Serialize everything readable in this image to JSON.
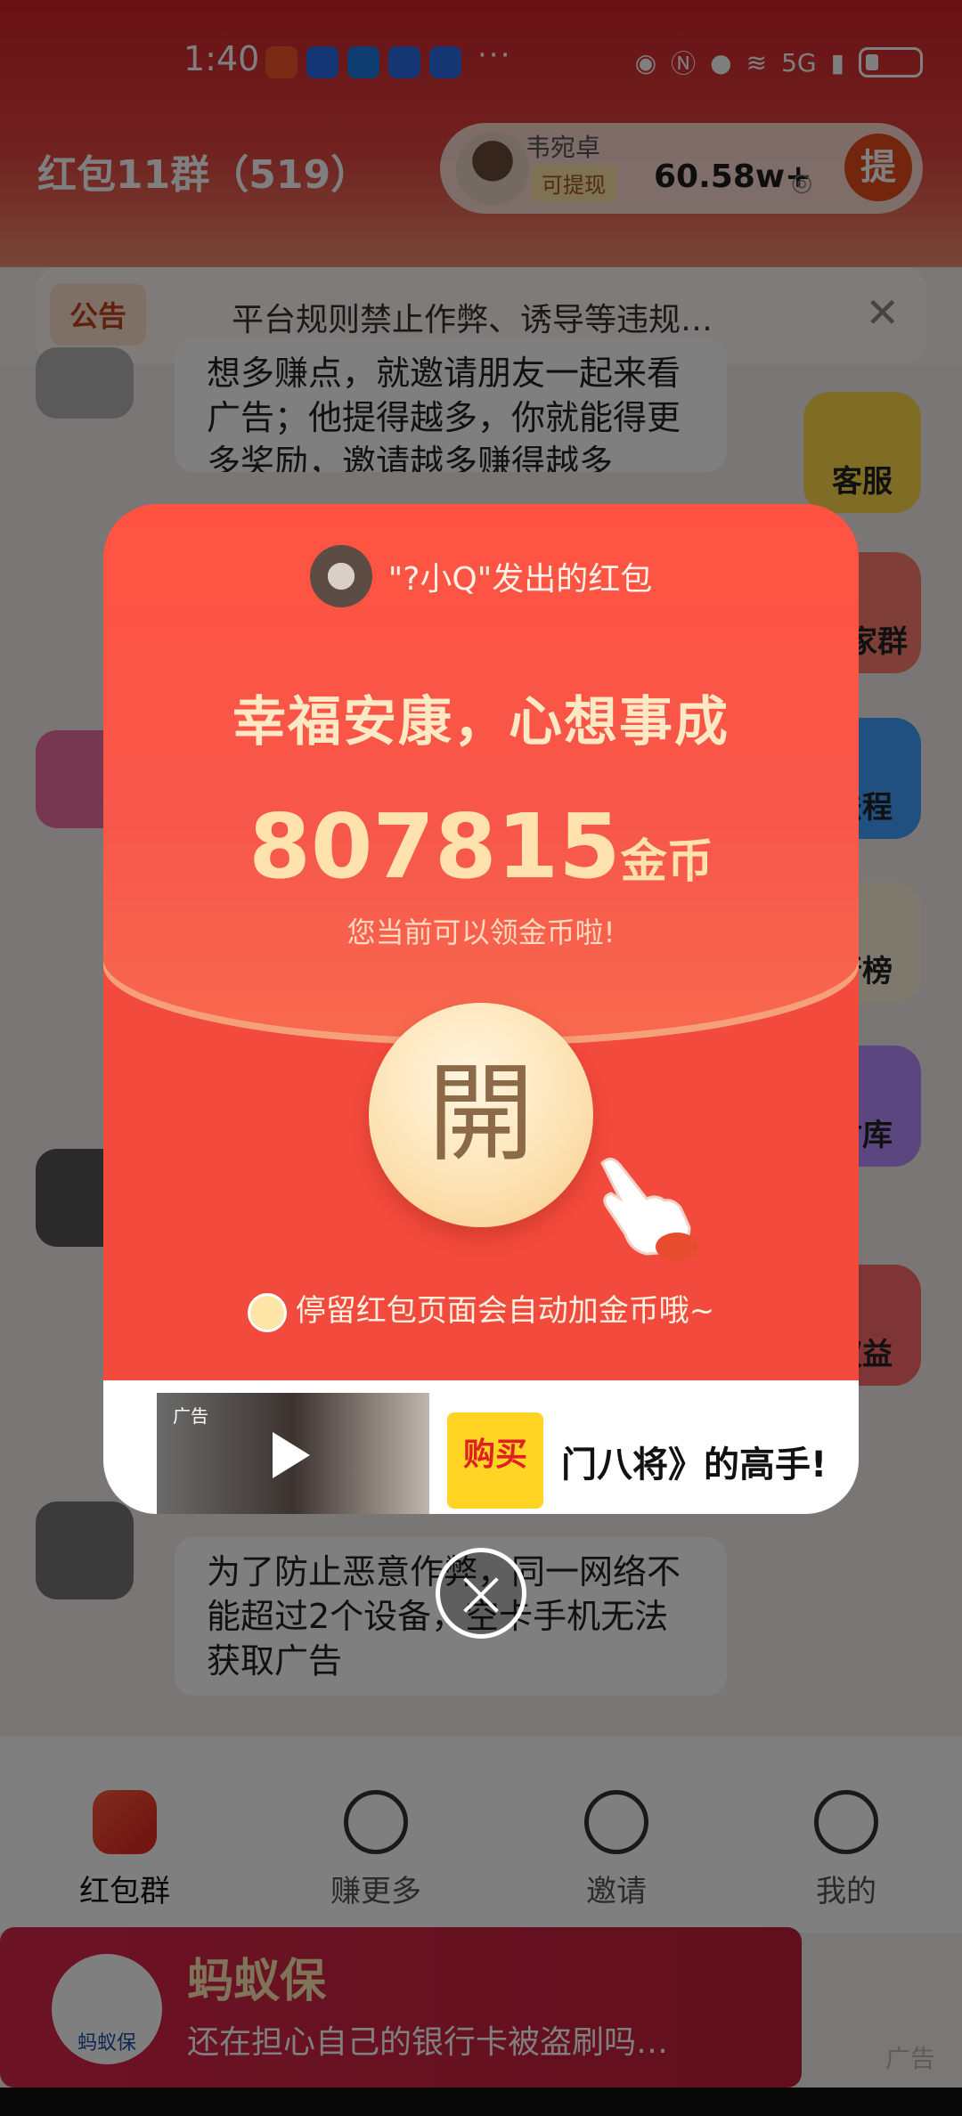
{
  "status_bar": {
    "time": "1:40",
    "more": "···",
    "network": "5G"
  },
  "header": {
    "group_title": "红包11群（519）",
    "user": {
      "name": "韦宛卓",
      "withdraw_tag": "可提现",
      "coins": "60.58w+",
      "withdraw_button": "提"
    }
  },
  "notice": {
    "badge": "公告",
    "text": "平台规则禁止作弊、诱导等违规…",
    "close": "✕"
  },
  "chat": {
    "messages": [
      {
        "text": "想多赚点，就邀请朋友一起来看广告；他提得越多，你就能得更多奖励，邀请越多赚得越多"
      },
      {
        "text": "为了防止恶意作弊，同一网络不能超过2个设备，空卡手机无法获取广告"
      }
    ]
  },
  "side_buttons": [
    "客服",
    "入家群",
    "法程",
    "行榜",
    "材库",
    "权益"
  ],
  "tabs": [
    {
      "label": "红包群"
    },
    {
      "label": "赚更多"
    },
    {
      "label": "邀请"
    },
    {
      "label": "我的"
    }
  ],
  "bottom_ad": {
    "brand": "蚂蚁保",
    "title": "蚂蚁保",
    "subtitle": "还在担心自己的银行卡被盗刷吗…",
    "ad_mark": "广告"
  },
  "red_packet": {
    "sender_text": "\"?小Q\"发出的红包",
    "blessing": "幸福安康，心想事成",
    "amount": "807815",
    "unit": "金币",
    "tip": "您当前可以领金币啦!",
    "open_label": "開",
    "auto_tip": "停留红包页面会自动加金币哦~",
    "ad": {
      "label": "广告",
      "buy": "购买",
      "title": "门八将》的高手!"
    }
  },
  "colors": {
    "primary_red": "#f24a3c",
    "gold_text": "#ffe2ad",
    "header_red": "#d2232a"
  }
}
